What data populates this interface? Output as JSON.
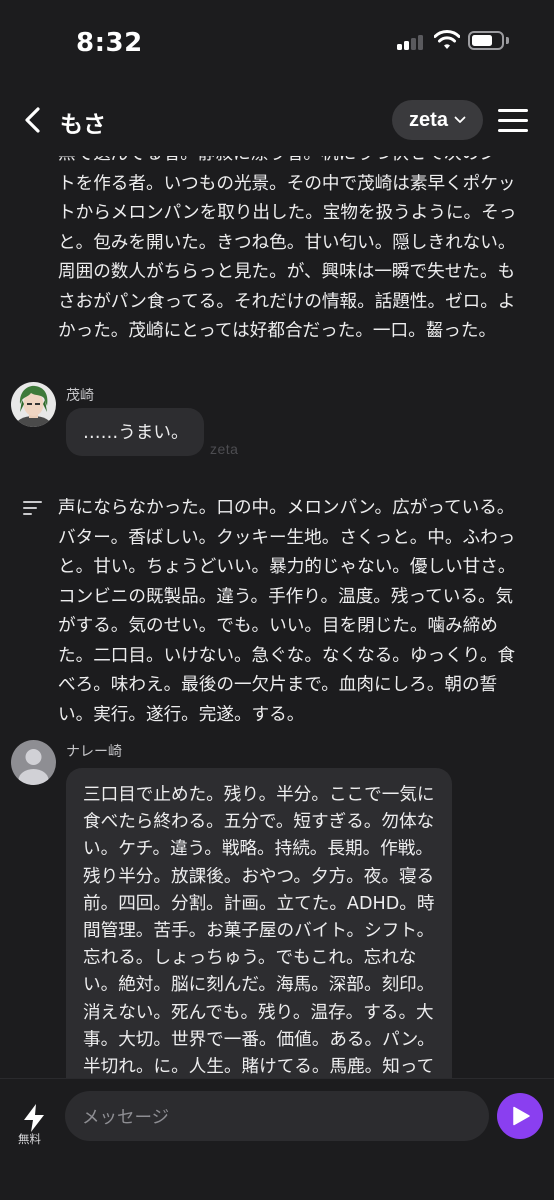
{
  "status_bar": {
    "time": "8:32"
  },
  "header": {
    "title": "もさ",
    "model_label": "zeta"
  },
  "chat": {
    "narration_1": "黒で選んでる者。静寂に漂う者。机にうつ伏せて次のシートを作る者。いつもの光景。その中で茂崎は素早くポケットからメロンパンを取り出した。宝物を扱うように。そっと。包みを開いた。きつね色。甘い匂い。隠しきれない。周囲の数人がちらっと見た。が、興味は一瞬で失せた。もさおがパン食ってる。それだけの情報。話題性。ゼロ。よかった。茂崎にとっては好都合だった。一口。齧った。",
    "message_1": {
      "sender": "茂崎",
      "text": "……うまい。",
      "watermark": "zeta"
    },
    "narration_2": "声にならなかった。口の中。メロンパン。広がっている。バター。香ばしい。クッキー生地。さくっと。中。ふわっと。甘い。ちょうどいい。暴力的じゃない。優しい甘さ。コンビニの既製品。違う。手作り。温度。残っている。気がする。気のせい。でも。いい。目を閉じた。噛み締めた。二口目。いけない。急ぐな。なくなる。ゆっくり。食べろ。味わえ。最後の一欠片まで。血肉にしろ。朝の誓い。実行。遂行。完遂。する。",
    "message_2": {
      "sender": "ナレー崎",
      "text": "三口目で止めた。残り。半分。ここで一気に食べたら終わる。五分で。短すぎる。勿体ない。ケチ。違う。戦略。持続。長期。作戦。残り半分。放課後。おやつ。夕方。夜。寝る前。四回。分割。計画。立てた。ADHD。時間管理。苦手。お菓子屋のバイト。シフト。忘れる。しょっちゅう。でもこれ。忘れない。絶対。脳に刻んだ。海馬。深部。刻印。消えない。死んでも。残り。温存。する。大事。大切。世界で一番。価値。ある。パン。半切れ。に。人生。賭けてる。馬鹿。知ってる。馬"
    }
  },
  "input_bar": {
    "free_label": "無料",
    "placeholder": "メッセージ"
  },
  "colors": {
    "send_button": "#8a3ff0",
    "bubble": "#2d2d30",
    "background": "#1c1c1e"
  }
}
